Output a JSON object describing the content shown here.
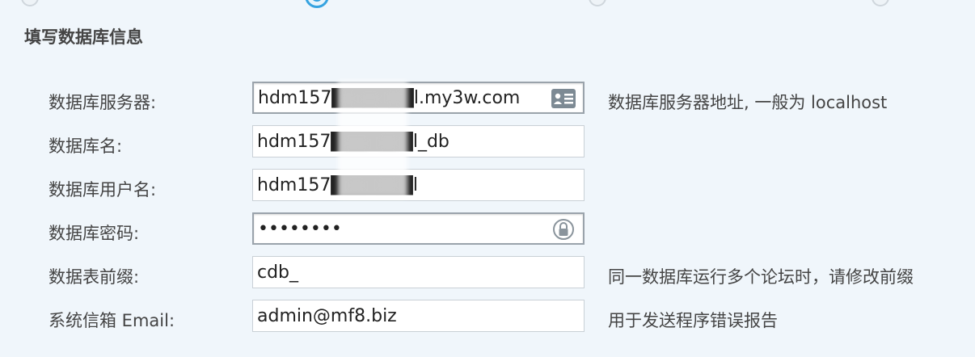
{
  "steps": {
    "count": 4,
    "active_index": 1
  },
  "section": {
    "title": "填写数据库信息"
  },
  "form": {
    "fields": [
      {
        "key": "dbhost",
        "label": "数据库服务器:",
        "value": "hdm157██████l.my3w.com",
        "hint": "数据库服务器地址, 一般为 localhost",
        "icon": "contact-card-icon",
        "type": "text"
      },
      {
        "key": "dbname",
        "label": "数据库名:",
        "value": "hdm157██████l_db",
        "hint": "",
        "icon": "",
        "type": "text"
      },
      {
        "key": "dbuser",
        "label": "数据库用户名:",
        "value": "hdm157██████l",
        "hint": "",
        "icon": "",
        "type": "text"
      },
      {
        "key": "dbpw",
        "label": "数据库密码:",
        "value": "••••••••",
        "hint": "",
        "icon": "password-lock-icon",
        "type": "password"
      },
      {
        "key": "tablepre",
        "label": "数据表前缀:",
        "value": "cdb_",
        "hint": "同一数据库运行多个论坛时，请修改前缀",
        "icon": "",
        "type": "text"
      },
      {
        "key": "adminemail",
        "label": "系统信箱 Email:",
        "value": "admin@mf8.biz",
        "hint": "用于发送程序错误报告",
        "icon": "",
        "type": "text"
      }
    ]
  },
  "colors": {
    "accent": "#36a3e0",
    "background": "#f0f6fb",
    "input_border": "#c9d0d6"
  }
}
